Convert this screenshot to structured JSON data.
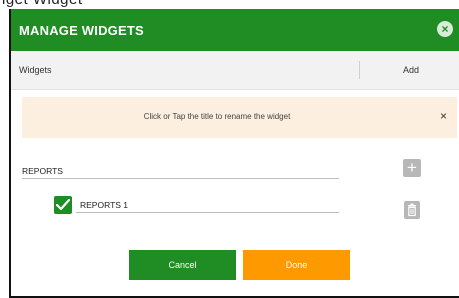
{
  "top_strip": {
    "text": "lget Widget"
  },
  "dialog": {
    "title": "MANAGE WIDGETS",
    "close_icon": "×"
  },
  "columns": {
    "widgets": "Widgets",
    "add": "Add"
  },
  "banner": {
    "message": "Click or Tap the title to rename the widget",
    "close": "×"
  },
  "report": {
    "name": "REPORTS",
    "add_icon": "+",
    "items": [
      {
        "label": "REPORTS 1",
        "checked": true
      }
    ]
  },
  "buttons": {
    "cancel": "Cancel",
    "done": "Done"
  },
  "colors": {
    "primary": "#1f8d23",
    "accent": "#ff9900",
    "banner": "#fcefdf",
    "icon_gray": "#b7b7b7"
  }
}
